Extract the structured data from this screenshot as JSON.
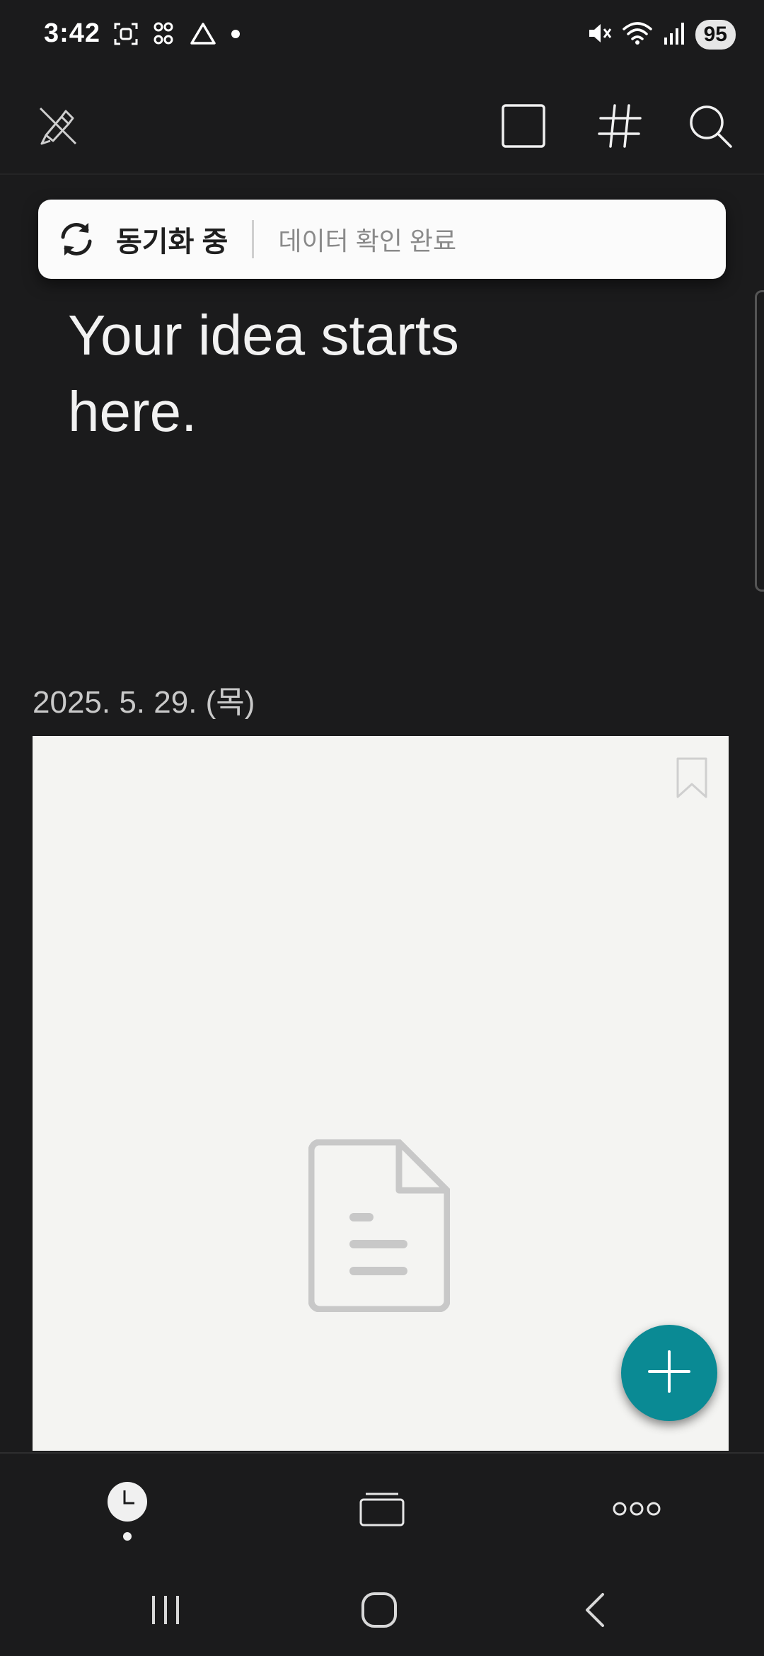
{
  "status_bar": {
    "time": "3:42",
    "battery": "95",
    "left_icons": [
      "screenshot-icon",
      "apps-icon",
      "drive-icon",
      "dot-icon"
    ],
    "right_icons": [
      "mute-icon",
      "wifi-icon",
      "signal-icon"
    ]
  },
  "app_bar": {
    "icons": [
      "pen-off-icon",
      "square-icon",
      "hashtag-icon",
      "search-icon"
    ]
  },
  "sync_toast": {
    "title": "동기화 중",
    "detail": "데이터 확인 완료"
  },
  "hero": {
    "title": "Your idea starts here."
  },
  "notes": {
    "date": "2025. 5. 29. (목)"
  },
  "fab": {
    "icon": "plus-icon"
  },
  "bottom_nav": {
    "items": [
      "clock-icon",
      "stack-icon",
      "more-icon"
    ],
    "active_index": 0
  },
  "system_nav": [
    "recents-icon",
    "home-icon",
    "back-icon"
  ],
  "colors": {
    "background": "#1b1b1c",
    "accent": "#0a8a94",
    "card": "#f4f4f2"
  }
}
